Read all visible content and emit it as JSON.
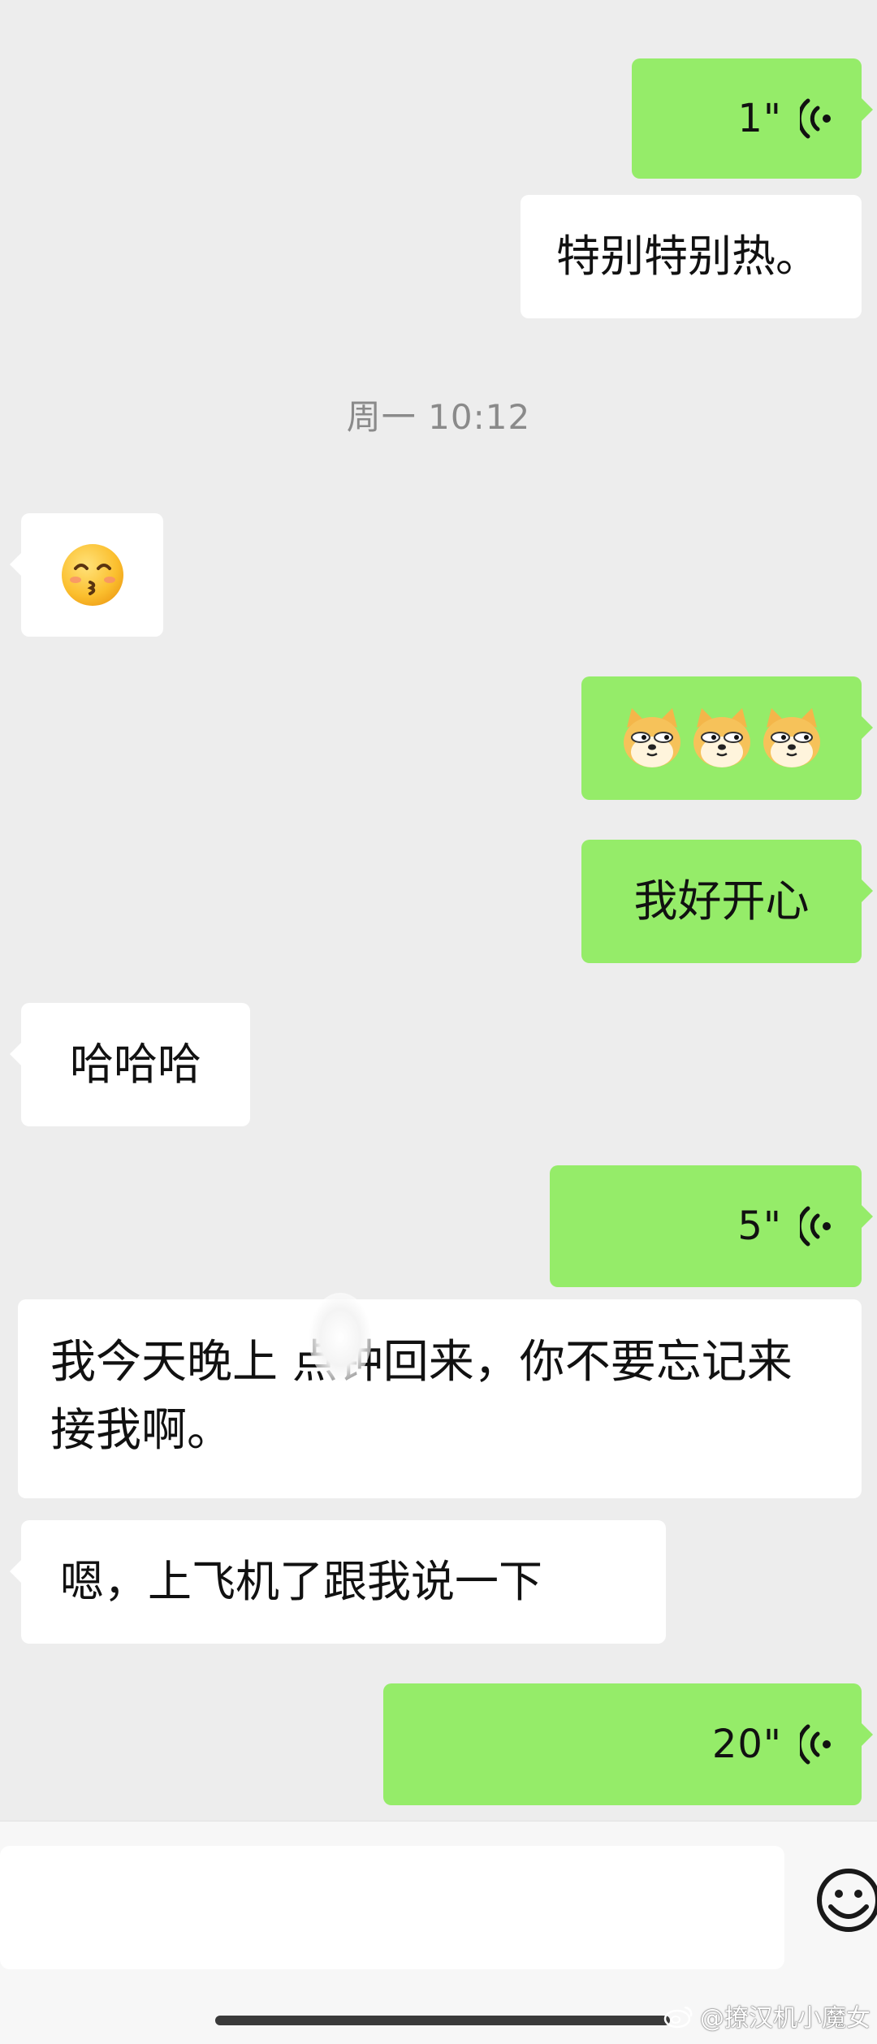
{
  "messages": {
    "voice1": {
      "duration": "1\""
    },
    "text_hot": "特别特别热。",
    "timestamp": "周一 10:12",
    "emoji_kiss": {
      "icon": "kissing-smiling-eyes-emoji"
    },
    "doge_emojis": {
      "icon": "doge-emoji",
      "count": 3
    },
    "text_happy": "我好开心",
    "text_haha": "哈哈哈",
    "voice2": {
      "duration": "5\""
    },
    "text_pickup": "我今天晚上  点钟回来，你不要忘记来接我啊。",
    "text_plane": "嗯，上飞机了跟我说一下",
    "voice3": {
      "duration": "20\""
    }
  },
  "input": {
    "placeholder": ""
  },
  "watermark": {
    "text": "@撩汉机小魔女"
  },
  "colors": {
    "background": "#ededed",
    "my_bubble": "#95ec69",
    "other_bubble": "#ffffff",
    "timestamp_text": "#8a8a8a"
  }
}
